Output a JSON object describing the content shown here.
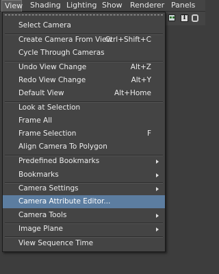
{
  "menubar": {
    "items": [
      "View",
      "Shading",
      "Lighting",
      "Show",
      "Renderer",
      "Panels"
    ]
  },
  "toolstrip": {
    "text_icon_glyph": "T"
  },
  "view_menu": {
    "items": [
      {
        "label": "Select Camera",
        "shortcut": "",
        "submenu": false
      },
      {
        "label": "Create Camera From View",
        "shortcut": "Ctrl+Shift+C",
        "submenu": false
      },
      {
        "label": "Cycle Through Cameras",
        "shortcut": "",
        "submenu": false
      },
      {
        "label": "Undo View Change",
        "shortcut": "Alt+Z",
        "submenu": false
      },
      {
        "label": "Redo View Change",
        "shortcut": "Alt+Y",
        "submenu": false
      },
      {
        "label": "Default View",
        "shortcut": "Alt+Home",
        "submenu": false
      },
      {
        "label": "Look at Selection",
        "shortcut": "",
        "submenu": false
      },
      {
        "label": "Frame All",
        "shortcut": "",
        "submenu": false
      },
      {
        "label": "Frame Selection",
        "shortcut": "F",
        "submenu": false
      },
      {
        "label": "Align Camera To Polygon",
        "shortcut": "",
        "submenu": false
      },
      {
        "label": "Predefined Bookmarks",
        "shortcut": "",
        "submenu": true
      },
      {
        "label": "Bookmarks",
        "shortcut": "",
        "submenu": true
      },
      {
        "label": "Camera Settings",
        "shortcut": "",
        "submenu": true
      },
      {
        "label": "Camera Attribute Editor...",
        "shortcut": "",
        "submenu": false,
        "highlighted": true
      },
      {
        "label": "Camera Tools",
        "shortcut": "",
        "submenu": true
      },
      {
        "label": "Image Plane",
        "shortcut": "",
        "submenu": true
      },
      {
        "label": "View Sequence Time",
        "shortcut": "",
        "submenu": false
      }
    ]
  },
  "colors": {
    "menu_background": "#444444",
    "highlight": "#5c7da0",
    "text": "#ededed"
  }
}
